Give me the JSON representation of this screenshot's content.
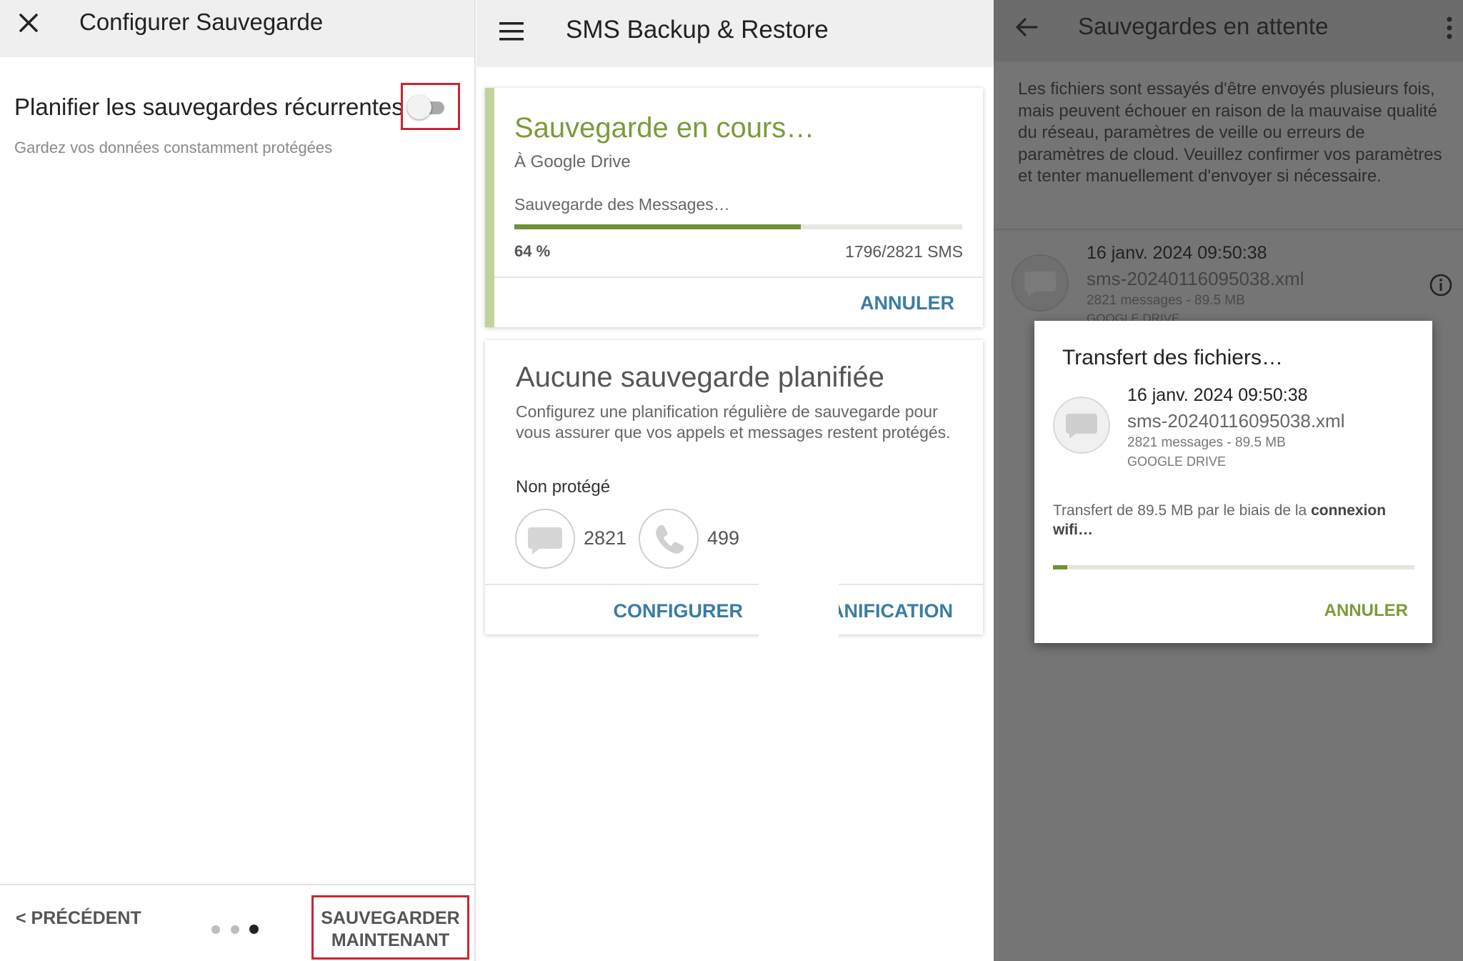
{
  "panel1": {
    "title": "Configurer Sauvegarde",
    "recurring_label": "Planifier les sauvegardes récurrentes",
    "recurring_sub": "Gardez vos données constamment protégées",
    "toggle_on": false,
    "prev_label": "< PRÉCÉDENT",
    "save_now_line1": "SAUVEGARDER",
    "save_now_line2": "MAINTENANT",
    "pager": {
      "total": 3,
      "current": 3
    },
    "highlight_color": "#d0232f"
  },
  "panel2": {
    "app_title": "SMS Backup & Restore",
    "backup_card": {
      "title": "Sauvegarde en cours…",
      "destination": "À Google Drive",
      "status": "Sauvegarde des Messages…",
      "progress_percent": 64,
      "percent_label": "64 %",
      "count_label": "1796/2821 SMS",
      "cancel_label": "ANNULER"
    },
    "schedule_card": {
      "title": "Aucune sauvegarde planifiée",
      "description": "Configurez une planification régulière de sauvegarde pour vous assurer que vos appels et messages restent protégés.",
      "status": "Non protégé",
      "messages_count": "2821",
      "calls_count": "499",
      "configure_label": "CONFIGURER",
      "schedule_label_visible": "ANIFICATION"
    },
    "accent_green": "#7c9a3a",
    "accent_blue": "#3a7ca5"
  },
  "panel3": {
    "title": "Sauvegardes en attente",
    "description": "Les fichiers sont essayés d'être envoyés plusieurs fois, mais peuvent échouer en raison de la mauvaise qualité du réseau, paramètres de veille ou erreurs de paramètres de cloud. Veuillez confirmer vos paramètres et tenter manuellement d'envoyer si nécessaire.",
    "item": {
      "date": "16 janv. 2024 09:50:38",
      "filename": "sms-20240116095038.xml",
      "meta": "2821 messages - 89.5 MB",
      "destination": "GOOGLE DRIVE"
    },
    "dialog": {
      "title": "Transfert des fichiers…",
      "date": "16 janv. 2024 09:50:38",
      "filename": "sms-20240116095038.xml",
      "meta": "2821 messages - 89.5 MB",
      "destination": "GOOGLE DRIVE",
      "transfer_text": "Transfert de 89.5 MB par le biais de la ",
      "transfer_bold": "connexion wifi",
      "transfer_end": "…",
      "progress_percent": 4,
      "cancel_label": "ANNULER"
    }
  }
}
